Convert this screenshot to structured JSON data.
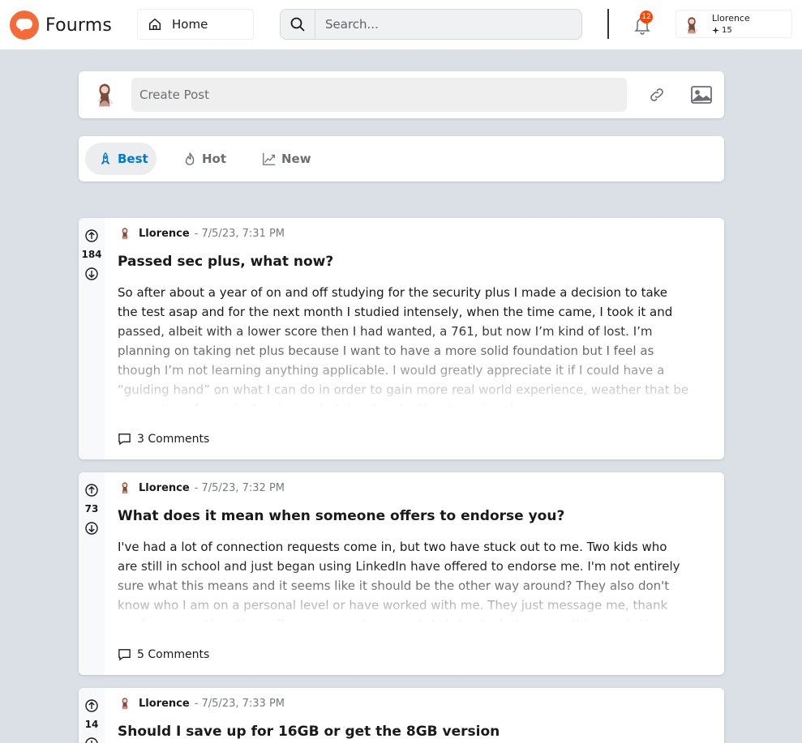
{
  "header": {
    "brand": "Fourms",
    "home_label": "Home",
    "search_placeholder": "Search...",
    "notification_count": "12",
    "user": {
      "name": "Llorence",
      "karma": "15"
    }
  },
  "create_post": {
    "placeholder": "Create Post"
  },
  "sort_tabs": [
    {
      "label": "Best",
      "active": true,
      "icon": "rocket-icon"
    },
    {
      "label": "Hot",
      "active": false,
      "icon": "flame-icon"
    },
    {
      "label": "New",
      "active": false,
      "icon": "trending-icon"
    }
  ],
  "posts": [
    {
      "votes": "184",
      "author": "Llorence",
      "time": "- 7/5/23, 7:31 PM",
      "title": "Passed sec plus, what now?",
      "body": "So after about a year of on and off studying for the security plus I made a decision to take the test asap and for the next month I studied intensely, when the time came, I took it and passed, albeit with a lower score then I had wanted, a 761, but now I’m kind of lost. I’m planning on taking net plus because I want to have a more solid foundation but I feel as though I’m not learning anything applicable. I would greatly appreciate it if I could have a “guiding hand” on what I can do in order to gain more real world experience, weather that be suggestions for projects, classes to take etc. etc. thank you in advance.",
      "comments": "3 Comments"
    },
    {
      "votes": "73",
      "author": "Llorence",
      "time": "- 7/5/23, 7:32 PM",
      "title": "What does it mean when someone offers to endorse you?",
      "body": "I've had a lot of connection requests come in, but two have stuck out to me. Two kids who are still in school and just began using LinkedIn have offered to endorse me. I'm not entirely sure what this means and it seems like it should be the other way around? They also don't know who I am on a personal level or have worked with me. They just message me, thank me for connecting, then offer me an endorsement. Lol. Am I missing something, or is there some other meaning to this?",
      "comments": "5 Comments"
    },
    {
      "votes": "14",
      "author": "Llorence",
      "time": "- 7/5/23, 7:33 PM",
      "title": "Should I save up for 16GB or get the 8GB version"
    }
  ],
  "colors": {
    "brand": "#f26b38",
    "accent": "#0079d3",
    "badge": "#ff4500"
  }
}
